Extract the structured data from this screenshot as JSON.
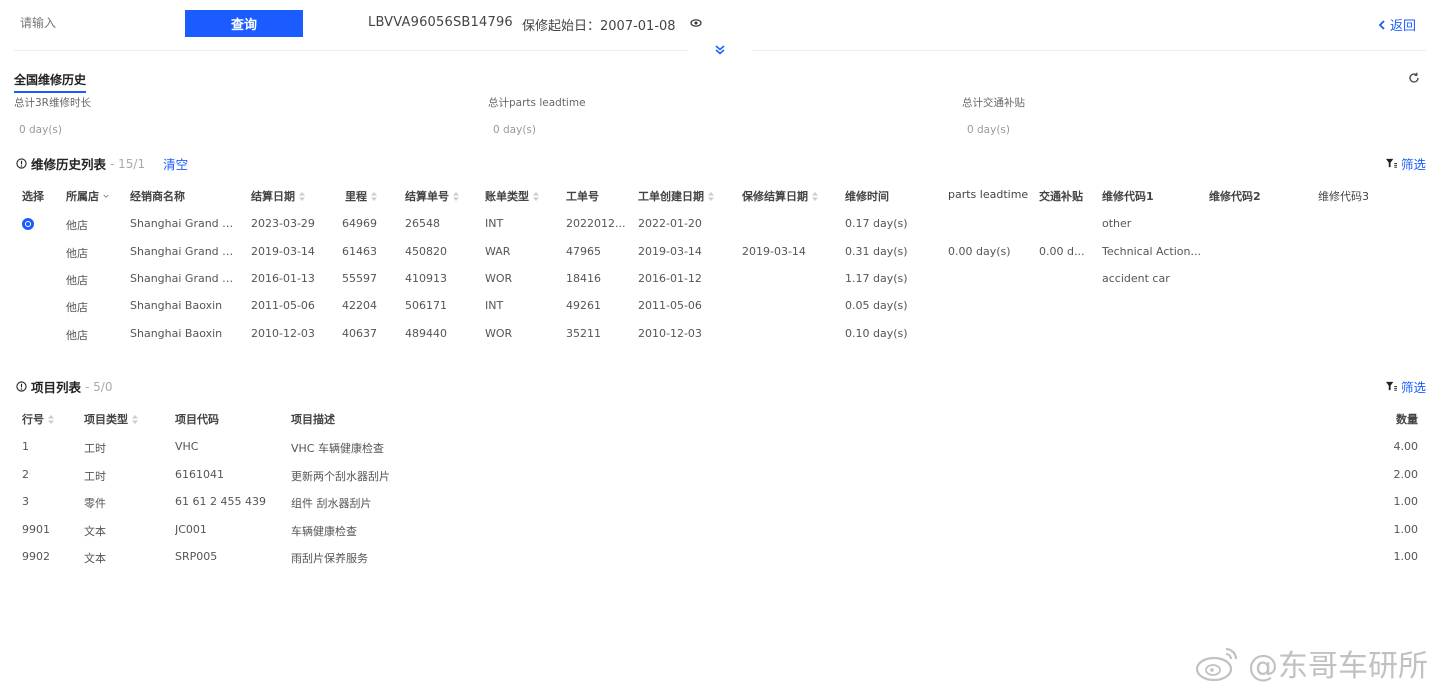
{
  "search": {
    "placeholder": "请输入",
    "query_label": "查询"
  },
  "vehicle": {
    "vin": "LBVVA96056SB14796",
    "warranty_start": "保修起始日：2007-01-08"
  },
  "nav": {
    "back_label": "返回"
  },
  "tab": {
    "title": "全国维修历史"
  },
  "stats": [
    {
      "label": "总计3R维修时长",
      "value": "0 day(s)"
    },
    {
      "label": "总计parts leadtime",
      "value": "0 day(s)"
    },
    {
      "label": "总计交通补贴",
      "value": "0 day(s)"
    }
  ],
  "history": {
    "title": "维修历史列表",
    "count": "- 15/1",
    "clear_label": "清空",
    "filter_label": "筛选",
    "columns": [
      "选择",
      "所属店",
      "经销商名称",
      "结算日期",
      "里程",
      "结算单号",
      "账单类型",
      "工单号",
      "工单创建日期",
      "保修结算日期",
      "维修时间",
      "parts leadtime",
      "交通补贴",
      "维修代码1",
      "维修代码2",
      "维修代码3"
    ],
    "rows": [
      [
        "",
        "他店",
        "Shanghai Grand B...",
        "2023-03-29",
        "64969",
        "26548",
        "INT",
        "2022012...",
        "2022-01-20",
        "",
        "0.17 day(s)",
        "",
        "",
        "other",
        "",
        ""
      ],
      [
        "",
        "他店",
        "Shanghai Grand B...",
        "2019-03-14",
        "61463",
        "450820",
        "WAR",
        "47965",
        "2019-03-14",
        "2019-03-14",
        "0.31 day(s)",
        "0.00 day(s)",
        "0.00 d...",
        "Technical Action...",
        "",
        ""
      ],
      [
        "",
        "他店",
        "Shanghai Grand B...",
        "2016-01-13",
        "55597",
        "410913",
        "WOR",
        "18416",
        "2016-01-12",
        "",
        "1.17 day(s)",
        "",
        "",
        "accident car",
        "",
        ""
      ],
      [
        "",
        "他店",
        "Shanghai Baoxin",
        "2011-05-06",
        "42204",
        "506171",
        "INT",
        "49261",
        "2011-05-06",
        "",
        "0.05 day(s)",
        "",
        "",
        "",
        "",
        ""
      ],
      [
        "",
        "他店",
        "Shanghai Baoxin",
        "2010-12-03",
        "40637",
        "489440",
        "WOR",
        "35211",
        "2010-12-03",
        "",
        "0.10 day(s)",
        "",
        "",
        "",
        "",
        ""
      ]
    ]
  },
  "items": {
    "title": "项目列表",
    "count": "- 5/0",
    "filter_label": "筛选",
    "columns": [
      "行号",
      "项目类型",
      "项目代码",
      "项目描述",
      "数量"
    ],
    "rows": [
      [
        "1",
        "工时",
        "VHC",
        "VHC 车辆健康检查",
        "4.00"
      ],
      [
        "2",
        "工时",
        "6161041",
        "更新两个刮水器刮片",
        "2.00"
      ],
      [
        "3",
        "零件",
        "61 61 2 455 439",
        "组件 刮水器刮片",
        "1.00"
      ],
      [
        "9901",
        "文本",
        "JC001",
        "车辆健康检查",
        "1.00"
      ],
      [
        "9902",
        "文本",
        "SRP005",
        "雨刮片保养服务",
        "1.00"
      ]
    ]
  },
  "watermark": {
    "text": "@东哥车研所"
  },
  "colors": {
    "accent": "#1a5cff",
    "divider": "#e8eef5"
  }
}
